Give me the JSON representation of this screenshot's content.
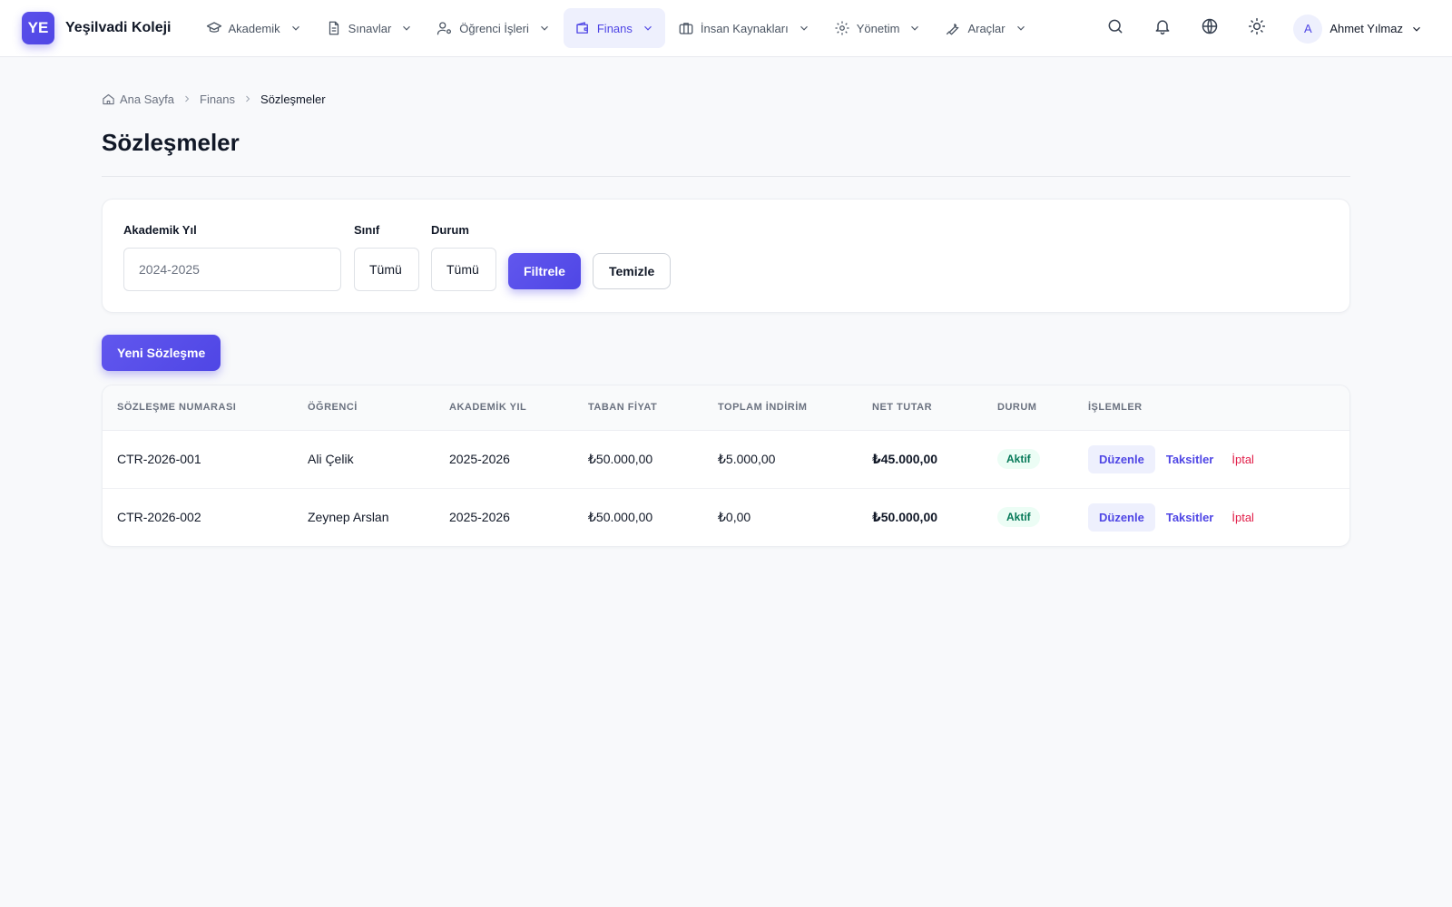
{
  "brand": {
    "logo_text": "YE",
    "name": "Yeşilvadi Koleji"
  },
  "nav": {
    "items": [
      {
        "label": "Akademik",
        "icon": "graduation-cap-icon"
      },
      {
        "label": "Sınavlar",
        "icon": "document-icon"
      },
      {
        "label": "Öğrenci İşleri",
        "icon": "user-gear-icon"
      },
      {
        "label": "Finans",
        "icon": "wallet-icon",
        "active": true
      },
      {
        "label": "İnsan Kaynakları",
        "icon": "briefcase-icon"
      },
      {
        "label": "Yönetim",
        "icon": "gear-icon"
      },
      {
        "label": "Araçlar",
        "icon": "wrench-icon"
      }
    ]
  },
  "user": {
    "initial": "A",
    "name": "Ahmet Yılmaz"
  },
  "breadcrumb": {
    "home": "Ana Sayfa",
    "section": "Finans",
    "current": "Sözleşmeler"
  },
  "page": {
    "title": "Sözleşmeler"
  },
  "filters": {
    "academic_year": {
      "label": "Akademik Yıl",
      "placeholder": "2024-2025"
    },
    "class": {
      "label": "Sınıf",
      "value": "Tümü"
    },
    "status": {
      "label": "Durum",
      "value": "Tümü"
    },
    "filter_label": "Filtrele",
    "clear_label": "Temizle"
  },
  "new_contract_label": "Yeni Sözleşme",
  "table": {
    "headers": [
      "SÖZLEŞME NUMARASI",
      "ÖĞRENCİ",
      "AKADEMİK YIL",
      "TABAN FİYAT",
      "TOPLAM İNDİRİM",
      "NET TUTAR",
      "DURUM",
      "İŞLEMLER"
    ],
    "rows": [
      {
        "number": "CTR-2026-001",
        "student": "Ali Çelik",
        "year": "2025-2026",
        "base": "₺50.000,00",
        "discount": "₺5.000,00",
        "net": "₺45.000,00",
        "status": "Aktif"
      },
      {
        "number": "CTR-2026-002",
        "student": "Zeynep Arslan",
        "year": "2025-2026",
        "base": "₺50.000,00",
        "discount": "₺0,00",
        "net": "₺50.000,00",
        "status": "Aktif"
      }
    ],
    "actions": {
      "edit": "Düzenle",
      "installments": "Taksitler",
      "cancel": "İptal"
    }
  },
  "colors": {
    "accent": "#4f46e5",
    "success": "#047857",
    "danger": "#e11d48"
  }
}
